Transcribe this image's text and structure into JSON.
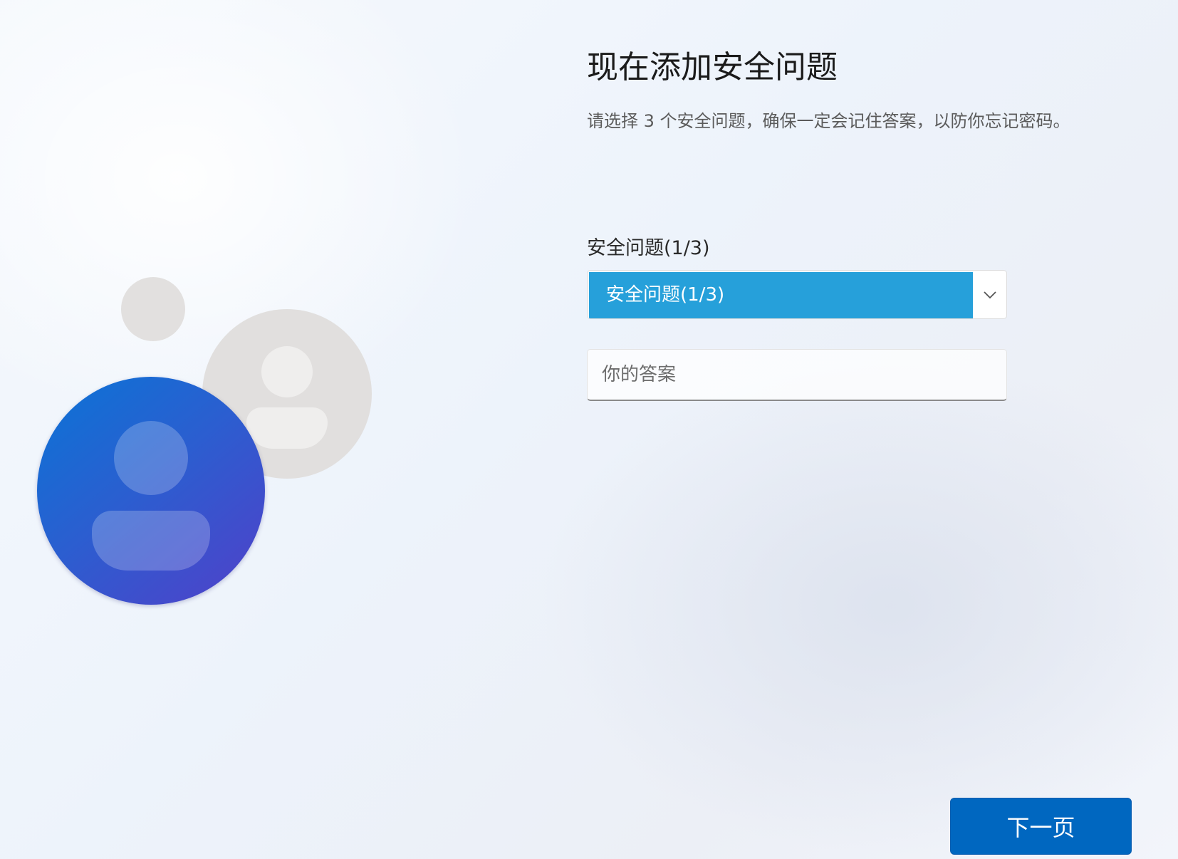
{
  "page": {
    "title": "现在添加安全问题",
    "description": "请选择 3 个安全问题，确保一定会记住答案，以防你忘记密码。"
  },
  "question": {
    "label": "安全问题(1/3)",
    "selected_value": "安全问题(1/3)",
    "chevron_icon": "chevron-down-icon"
  },
  "answer": {
    "placeholder": "你的答案",
    "value": ""
  },
  "footer": {
    "next_label": "下一页"
  },
  "colors": {
    "accent": "#0067c0",
    "selection_highlight": "#26a0da",
    "avatar_gradient_start": "#0a74d6",
    "avatar_gradient_end": "#5140c9",
    "avatar_grey": "#e1dfde"
  }
}
